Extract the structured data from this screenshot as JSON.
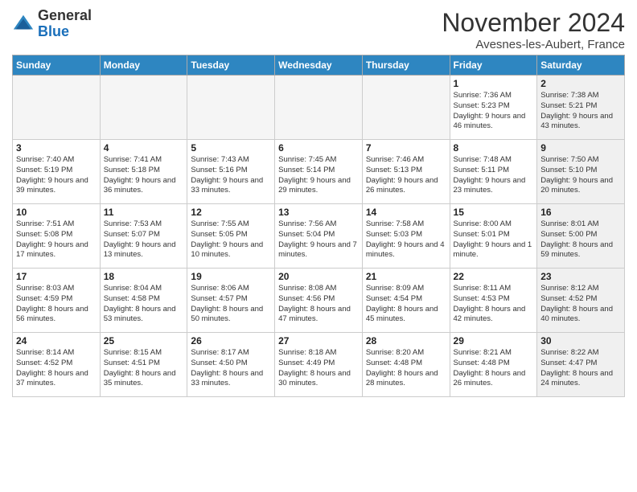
{
  "logo": {
    "general": "General",
    "blue": "Blue"
  },
  "title": "November 2024",
  "location": "Avesnes-les-Aubert, France",
  "days_of_week": [
    "Sunday",
    "Monday",
    "Tuesday",
    "Wednesday",
    "Thursday",
    "Friday",
    "Saturday"
  ],
  "weeks": [
    [
      {
        "day": "",
        "info": "",
        "empty": true
      },
      {
        "day": "",
        "info": "",
        "empty": true
      },
      {
        "day": "",
        "info": "",
        "empty": true
      },
      {
        "day": "",
        "info": "",
        "empty": true
      },
      {
        "day": "",
        "info": "",
        "empty": true
      },
      {
        "day": "1",
        "info": "Sunrise: 7:36 AM\nSunset: 5:23 PM\nDaylight: 9 hours\nand 46 minutes.",
        "empty": false,
        "shaded": false
      },
      {
        "day": "2",
        "info": "Sunrise: 7:38 AM\nSunset: 5:21 PM\nDaylight: 9 hours\nand 43 minutes.",
        "empty": false,
        "shaded": true
      }
    ],
    [
      {
        "day": "3",
        "info": "Sunrise: 7:40 AM\nSunset: 5:19 PM\nDaylight: 9 hours\nand 39 minutes.",
        "empty": false,
        "shaded": false
      },
      {
        "day": "4",
        "info": "Sunrise: 7:41 AM\nSunset: 5:18 PM\nDaylight: 9 hours\nand 36 minutes.",
        "empty": false,
        "shaded": false
      },
      {
        "day": "5",
        "info": "Sunrise: 7:43 AM\nSunset: 5:16 PM\nDaylight: 9 hours\nand 33 minutes.",
        "empty": false,
        "shaded": false
      },
      {
        "day": "6",
        "info": "Sunrise: 7:45 AM\nSunset: 5:14 PM\nDaylight: 9 hours\nand 29 minutes.",
        "empty": false,
        "shaded": false
      },
      {
        "day": "7",
        "info": "Sunrise: 7:46 AM\nSunset: 5:13 PM\nDaylight: 9 hours\nand 26 minutes.",
        "empty": false,
        "shaded": false
      },
      {
        "day": "8",
        "info": "Sunrise: 7:48 AM\nSunset: 5:11 PM\nDaylight: 9 hours\nand 23 minutes.",
        "empty": false,
        "shaded": false
      },
      {
        "day": "9",
        "info": "Sunrise: 7:50 AM\nSunset: 5:10 PM\nDaylight: 9 hours\nand 20 minutes.",
        "empty": false,
        "shaded": true
      }
    ],
    [
      {
        "day": "10",
        "info": "Sunrise: 7:51 AM\nSunset: 5:08 PM\nDaylight: 9 hours\nand 17 minutes.",
        "empty": false,
        "shaded": false
      },
      {
        "day": "11",
        "info": "Sunrise: 7:53 AM\nSunset: 5:07 PM\nDaylight: 9 hours\nand 13 minutes.",
        "empty": false,
        "shaded": false
      },
      {
        "day": "12",
        "info": "Sunrise: 7:55 AM\nSunset: 5:05 PM\nDaylight: 9 hours\nand 10 minutes.",
        "empty": false,
        "shaded": false
      },
      {
        "day": "13",
        "info": "Sunrise: 7:56 AM\nSunset: 5:04 PM\nDaylight: 9 hours\nand 7 minutes.",
        "empty": false,
        "shaded": false
      },
      {
        "day": "14",
        "info": "Sunrise: 7:58 AM\nSunset: 5:03 PM\nDaylight: 9 hours\nand 4 minutes.",
        "empty": false,
        "shaded": false
      },
      {
        "day": "15",
        "info": "Sunrise: 8:00 AM\nSunset: 5:01 PM\nDaylight: 9 hours\nand 1 minute.",
        "empty": false,
        "shaded": false
      },
      {
        "day": "16",
        "info": "Sunrise: 8:01 AM\nSunset: 5:00 PM\nDaylight: 8 hours\nand 59 minutes.",
        "empty": false,
        "shaded": true
      }
    ],
    [
      {
        "day": "17",
        "info": "Sunrise: 8:03 AM\nSunset: 4:59 PM\nDaylight: 8 hours\nand 56 minutes.",
        "empty": false,
        "shaded": false
      },
      {
        "day": "18",
        "info": "Sunrise: 8:04 AM\nSunset: 4:58 PM\nDaylight: 8 hours\nand 53 minutes.",
        "empty": false,
        "shaded": false
      },
      {
        "day": "19",
        "info": "Sunrise: 8:06 AM\nSunset: 4:57 PM\nDaylight: 8 hours\nand 50 minutes.",
        "empty": false,
        "shaded": false
      },
      {
        "day": "20",
        "info": "Sunrise: 8:08 AM\nSunset: 4:56 PM\nDaylight: 8 hours\nand 47 minutes.",
        "empty": false,
        "shaded": false
      },
      {
        "day": "21",
        "info": "Sunrise: 8:09 AM\nSunset: 4:54 PM\nDaylight: 8 hours\nand 45 minutes.",
        "empty": false,
        "shaded": false
      },
      {
        "day": "22",
        "info": "Sunrise: 8:11 AM\nSunset: 4:53 PM\nDaylight: 8 hours\nand 42 minutes.",
        "empty": false,
        "shaded": false
      },
      {
        "day": "23",
        "info": "Sunrise: 8:12 AM\nSunset: 4:52 PM\nDaylight: 8 hours\nand 40 minutes.",
        "empty": false,
        "shaded": true
      }
    ],
    [
      {
        "day": "24",
        "info": "Sunrise: 8:14 AM\nSunset: 4:52 PM\nDaylight: 8 hours\nand 37 minutes.",
        "empty": false,
        "shaded": false
      },
      {
        "day": "25",
        "info": "Sunrise: 8:15 AM\nSunset: 4:51 PM\nDaylight: 8 hours\nand 35 minutes.",
        "empty": false,
        "shaded": false
      },
      {
        "day": "26",
        "info": "Sunrise: 8:17 AM\nSunset: 4:50 PM\nDaylight: 8 hours\nand 33 minutes.",
        "empty": false,
        "shaded": false
      },
      {
        "day": "27",
        "info": "Sunrise: 8:18 AM\nSunset: 4:49 PM\nDaylight: 8 hours\nand 30 minutes.",
        "empty": false,
        "shaded": false
      },
      {
        "day": "28",
        "info": "Sunrise: 8:20 AM\nSunset: 4:48 PM\nDaylight: 8 hours\nand 28 minutes.",
        "empty": false,
        "shaded": false
      },
      {
        "day": "29",
        "info": "Sunrise: 8:21 AM\nSunset: 4:48 PM\nDaylight: 8 hours\nand 26 minutes.",
        "empty": false,
        "shaded": false
      },
      {
        "day": "30",
        "info": "Sunrise: 8:22 AM\nSunset: 4:47 PM\nDaylight: 8 hours\nand 24 minutes.",
        "empty": false,
        "shaded": true
      }
    ]
  ]
}
